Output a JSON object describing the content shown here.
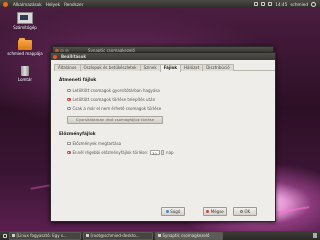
{
  "top_panel": {
    "menus": [
      "Alkalmazások",
      "Helyek",
      "Rendszer"
    ],
    "clock": "14:45",
    "user": "schmied"
  },
  "desktop_icons": [
    {
      "label": "Számítógép",
      "icon": "computer-icon"
    },
    {
      "label": "schmied mappája",
      "icon": "home-folder-icon"
    },
    {
      "label": "Lomtár",
      "icon": "trash-icon"
    }
  ],
  "bg_window": {
    "title": "Synaptic csomagkezelő"
  },
  "dialog": {
    "title": "Beállítások",
    "tabs": [
      "Általános",
      "Oszlopok és betűkészletek",
      "Színek",
      "Fájlok",
      "Hálózat",
      "Disztribúció"
    ],
    "active_tab": "Fájlok",
    "temp_files": {
      "heading": "Átmeneti fájlok",
      "options": [
        "Letöltött csomagok gyorsítótárban hagyása",
        "Letöltött csomagok törlése telepítés után",
        "Csak a már el nem érhető csomagok törlése"
      ],
      "selected_index": 1,
      "delete_button": "Gyorsítótárban lévő csomagfájlok törlése"
    },
    "history": {
      "heading": "Előzményfájlok",
      "keep_option": "Előzmények megtartása",
      "delete_older_prefix": "Ennél régebbi előzményfájlok törlése:",
      "days_value": "30",
      "days_unit": "nap"
    },
    "buttons": {
      "help": "Súgó",
      "cancel": "Mégse",
      "ok": "OK"
    }
  },
  "bottom_panel": {
    "tasks": [
      {
        "label": "[Linux fogyasztó: Egy s...",
        "icon": "browser-icon"
      },
      {
        "label": "[root@schmied-deskto...",
        "icon": "terminal-icon"
      },
      {
        "label": "Synaptic csomagkezelő",
        "icon": "package-icon"
      }
    ]
  },
  "colors": {
    "accent_radio": "#cc4444",
    "panel": "#3b3a36",
    "dialog_bg": "#efedea"
  }
}
